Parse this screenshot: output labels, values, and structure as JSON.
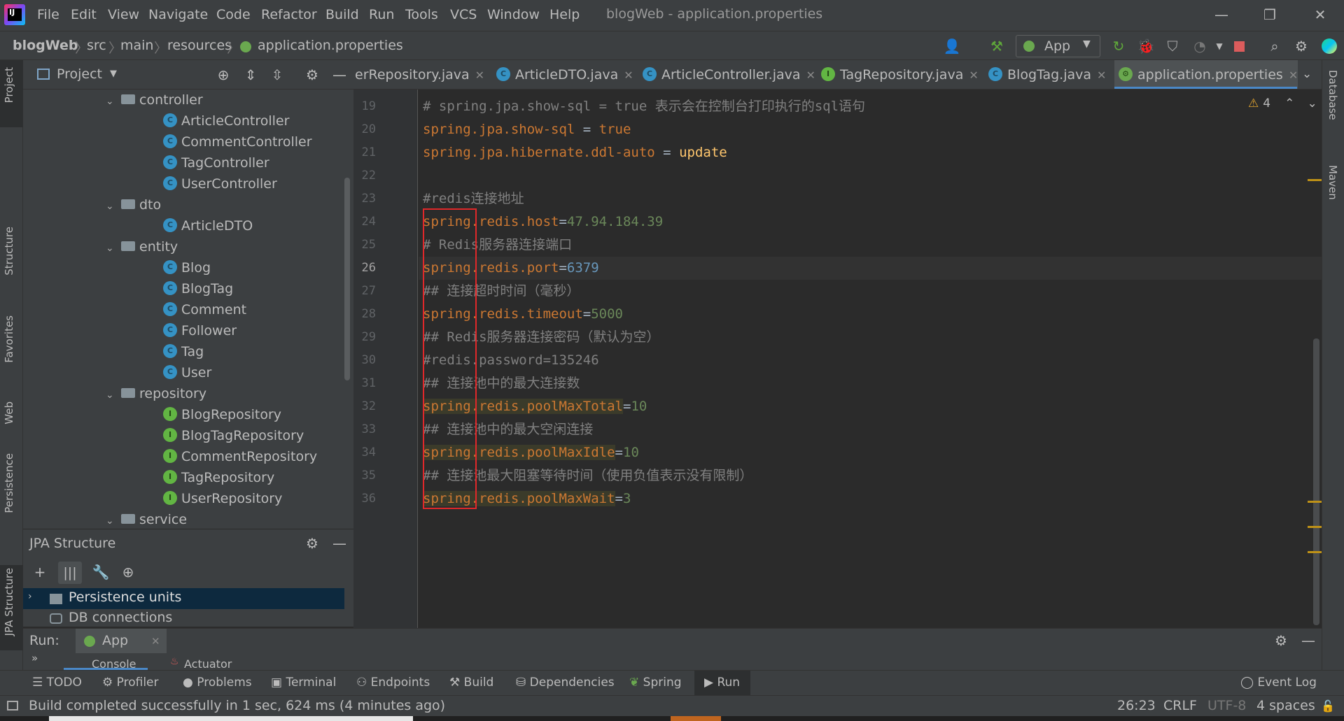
{
  "app": {
    "logo_text": "IJ",
    "window_title": "blogWeb - application.properties"
  },
  "menu": [
    "File",
    "Edit",
    "View",
    "Navigate",
    "Code",
    "Refactor",
    "Build",
    "Run",
    "Tools",
    "VCS",
    "Window",
    "Help"
  ],
  "window_controls": {
    "minimize": "—",
    "restore": "❐",
    "close": "✕"
  },
  "breadcrumb": [
    "blogWeb",
    "src",
    "main",
    "resources",
    "application.properties"
  ],
  "run_config": {
    "label": "App"
  },
  "left_strip": [
    "Project",
    "Structure",
    "Favorites",
    "Web",
    "Persistence",
    "JPA Structure"
  ],
  "right_strip": [
    "Database",
    "Maven"
  ],
  "project_panel": {
    "title": "Project",
    "tree": [
      {
        "label": "controller",
        "kind": "folder",
        "depth": 0,
        "expanded": true
      },
      {
        "label": "ArticleController",
        "kind": "class",
        "depth": 1
      },
      {
        "label": "CommentController",
        "kind": "class",
        "depth": 1
      },
      {
        "label": "TagController",
        "kind": "class",
        "depth": 1
      },
      {
        "label": "UserController",
        "kind": "class",
        "depth": 1
      },
      {
        "label": "dto",
        "kind": "folder",
        "depth": 0,
        "expanded": true
      },
      {
        "label": "ArticleDTO",
        "kind": "class",
        "depth": 1
      },
      {
        "label": "entity",
        "kind": "folder",
        "depth": 0,
        "expanded": true
      },
      {
        "label": "Blog",
        "kind": "class",
        "depth": 1
      },
      {
        "label": "BlogTag",
        "kind": "class",
        "depth": 1
      },
      {
        "label": "Comment",
        "kind": "class",
        "depth": 1
      },
      {
        "label": "Follower",
        "kind": "class",
        "depth": 1
      },
      {
        "label": "Tag",
        "kind": "class",
        "depth": 1
      },
      {
        "label": "User",
        "kind": "class",
        "depth": 1
      },
      {
        "label": "repository",
        "kind": "folder",
        "depth": 0,
        "expanded": true
      },
      {
        "label": "BlogRepository",
        "kind": "interface",
        "depth": 1
      },
      {
        "label": "BlogTagRepository",
        "kind": "interface",
        "depth": 1
      },
      {
        "label": "CommentRepository",
        "kind": "interface",
        "depth": 1
      },
      {
        "label": "TagRepository",
        "kind": "interface",
        "depth": 1
      },
      {
        "label": "UserRepository",
        "kind": "interface",
        "depth": 1
      },
      {
        "label": "service",
        "kind": "folder",
        "depth": 0,
        "expanded": true
      }
    ]
  },
  "jpa_panel": {
    "title": "JPA Structure",
    "items": [
      "Persistence units",
      "DB connections"
    ]
  },
  "editor_tabs": [
    {
      "label": "erRepository.java",
      "icon": "interface",
      "active": false
    },
    {
      "label": "ArticleDTO.java",
      "icon": "class",
      "active": false
    },
    {
      "label": "ArticleController.java",
      "icon": "class",
      "active": false
    },
    {
      "label": "TagRepository.java",
      "icon": "interface",
      "active": false
    },
    {
      "label": "BlogTag.java",
      "icon": "class",
      "active": false
    },
    {
      "label": "application.properties",
      "icon": "properties",
      "active": true
    }
  ],
  "warnings": {
    "count": "4"
  },
  "code": [
    {
      "n": "19",
      "segs": [
        {
          "t": "# spring.jpa.show-sql = true 表示会在控制台打印执行的sql语句",
          "c": "cm"
        }
      ]
    },
    {
      "n": "20",
      "segs": [
        {
          "t": "spring.jpa.show-sql",
          "c": "k"
        },
        {
          "t": " = ",
          "c": "p"
        },
        {
          "t": "true",
          "c": "k"
        }
      ]
    },
    {
      "n": "21",
      "segs": [
        {
          "t": "spring.jpa.hibernate.ddl-auto",
          "c": "k"
        },
        {
          "t": " = ",
          "c": "p"
        },
        {
          "t": "update",
          "c": "kw"
        }
      ]
    },
    {
      "n": "22",
      "segs": []
    },
    {
      "n": "23",
      "segs": [
        {
          "t": "#redis连接地址",
          "c": "cm"
        }
      ]
    },
    {
      "n": "24",
      "segs": [
        {
          "t": "spring.redis.host",
          "c": "k"
        },
        {
          "t": "=",
          "c": "p"
        },
        {
          "t": "47.94.184.39",
          "c": "v"
        }
      ]
    },
    {
      "n": "25",
      "segs": [
        {
          "t": "# Redis服务器连接端口",
          "c": "cm"
        }
      ]
    },
    {
      "n": "26",
      "segs": [
        {
          "t": "spring.redis.port",
          "c": "k"
        },
        {
          "t": "=",
          "c": "p"
        },
        {
          "t": "6379",
          "c": "num"
        }
      ]
    },
    {
      "n": "27",
      "segs": [
        {
          "t": "## 连接超时时间（毫秒）",
          "c": "cm"
        }
      ]
    },
    {
      "n": "28",
      "segs": [
        {
          "t": "spring.redis.timeout",
          "c": "k"
        },
        {
          "t": "=",
          "c": "p"
        },
        {
          "t": "5000",
          "c": "v"
        }
      ]
    },
    {
      "n": "29",
      "segs": [
        {
          "t": "## Redis服务器连接密码（默认为空）",
          "c": "cm"
        }
      ]
    },
    {
      "n": "30",
      "segs": [
        {
          "t": "#redis.password=135246",
          "c": "cm"
        }
      ]
    },
    {
      "n": "31",
      "segs": [
        {
          "t": "## 连接池中的最大连接数",
          "c": "cm"
        }
      ]
    },
    {
      "n": "32",
      "segs": [
        {
          "t": "spring.redis.poolMaxTotal",
          "c": "k hl"
        },
        {
          "t": "=",
          "c": "p"
        },
        {
          "t": "10",
          "c": "v"
        }
      ]
    },
    {
      "n": "33",
      "segs": [
        {
          "t": "## 连接池中的最大空闲连接",
          "c": "cm"
        }
      ]
    },
    {
      "n": "34",
      "segs": [
        {
          "t": "spring.redis.poolMaxIdle",
          "c": "k hl"
        },
        {
          "t": "=",
          "c": "p"
        },
        {
          "t": "10",
          "c": "v"
        }
      ]
    },
    {
      "n": "35",
      "segs": [
        {
          "t": "## 连接池最大阻塞等待时间（使用负值表示没有限制）",
          "c": "cm"
        }
      ]
    },
    {
      "n": "36",
      "segs": [
        {
          "t": "spring.redis.poolMaxWait",
          "c": "k hl"
        },
        {
          "t": "=",
          "c": "p"
        },
        {
          "t": "3",
          "c": "v"
        }
      ]
    }
  ],
  "current_line": "26",
  "run_panel": {
    "label": "Run:",
    "config": "App",
    "tabs": [
      "Console",
      "Actuator"
    ]
  },
  "bottom_tools": [
    "TODO",
    "Profiler",
    "Problems",
    "Terminal",
    "Endpoints",
    "Build",
    "Dependencies",
    "Spring",
    "Run"
  ],
  "event_log": "Event Log",
  "status": {
    "message": "Build completed successfully in 1 sec, 624 ms (4 minutes ago)",
    "position": "26:23",
    "line_sep": "CRLF",
    "encoding": "UTF-8",
    "indent": "4 spaces"
  }
}
